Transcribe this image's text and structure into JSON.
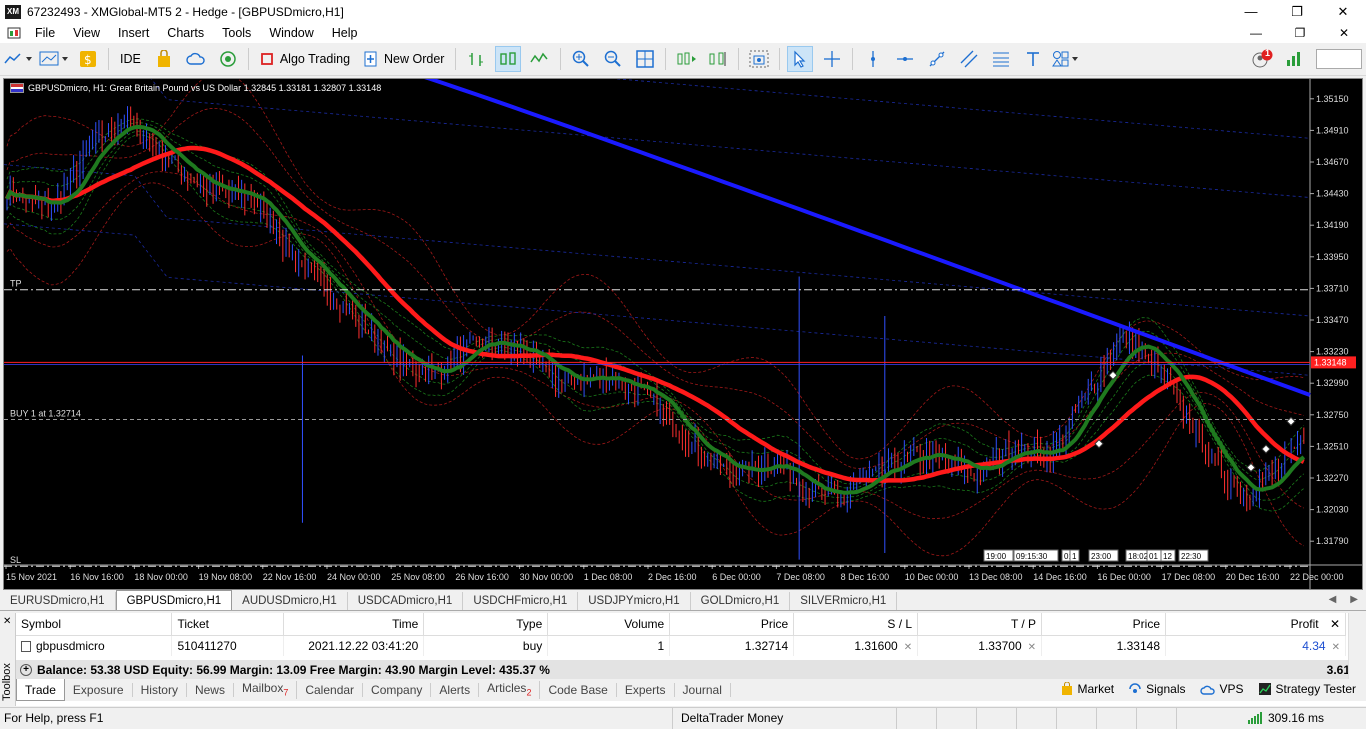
{
  "window": {
    "title": "67232493 - XMGlobal-MT5 2 - Hedge - [GBPUSDmicro,H1]",
    "logo_text": "XM"
  },
  "menu": [
    "File",
    "View",
    "Insert",
    "Charts",
    "Tools",
    "Window",
    "Help"
  ],
  "toolbar": {
    "ide_label": "IDE",
    "algo_trading_label": "Algo Trading",
    "new_order_label": "New Order",
    "notification_count": "1"
  },
  "chart": {
    "header": "GBPUSDmicro, H1:  Great Britain Pound vs US Dollar  1.32845 1.33181 1.32807 1.33148",
    "tp_label": "TP",
    "sl_label": "SL",
    "buy_label": "BUY 1 at 1.32714",
    "price_axis": [
      "1.35150",
      "1.34910",
      "1.34670",
      "1.34430",
      "1.34190",
      "1.33950",
      "1.33710",
      "1.33470",
      "1.33230",
      "1.32990",
      "1.32750",
      "1.32510",
      "1.32270",
      "1.32030",
      "1.31790"
    ],
    "current_price": "1.33148",
    "time_axis": [
      "15 Nov 2021",
      "16 Nov 16:00",
      "18 Nov 00:00",
      "19 Nov 08:00",
      "22 Nov 16:00",
      "24 Nov 00:00",
      "25 Nov 08:00",
      "26 Nov 16:00",
      "30 Nov 00:00",
      "1 Dec 08:00",
      "2 Dec 16:00",
      "6 Dec 00:00",
      "7 Dec 08:00",
      "8 Dec 16:00",
      "10 Dec 00:00",
      "13 Dec 08:00",
      "14 Dec 16:00",
      "16 Dec 00:00",
      "17 Dec 08:00",
      "20 Dec 16:00",
      "22 Dec 00:00"
    ],
    "period_sep_labels": [
      "19:00",
      "09:15:30",
      "01",
      "1",
      "23:00",
      "18:02",
      "01",
      "12",
      "22:30"
    ],
    "colors": {
      "background": "#000000",
      "ma_fast": "#1f7a1f",
      "ma_mid": "#ff1a1a",
      "ma_slow": "#1a1aff",
      "candle_up": "#3050ff",
      "candle_down": "#ff3030",
      "price_line": "#ff2020"
    }
  },
  "symbol_tabs": [
    "EURUSDmicro,H1",
    "GBPUSDmicro,H1",
    "AUDUSDmicro,H1",
    "USDCADmicro,H1",
    "USDCHFmicro,H1",
    "USDJPYmicro,H1",
    "GOLDmicro,H1",
    "SILVERmicro,H1"
  ],
  "trade_table": {
    "headers": [
      "Symbol",
      "Ticket",
      "Time",
      "Type",
      "Volume",
      "Price",
      "S / L",
      "T / P",
      "Price",
      "Profit"
    ],
    "row": {
      "symbol": "gbpusdmicro",
      "ticket": "510411270",
      "time": "2021.12.22 03:41:20",
      "type": "buy",
      "volume": "1",
      "price": "1.32714",
      "sl": "1.31600",
      "tp": "1.33700",
      "current": "1.33148",
      "profit": "4.34"
    },
    "balance_text": "Balance: 53.38 USD  Equity: 56.99  Margin: 13.09  Free Margin: 43.90  Margin Level: 435.37 %",
    "balance_profit": "3.61"
  },
  "toolbox_label": "Toolbox",
  "toolbox_tabs": [
    {
      "label": "Trade",
      "badge": ""
    },
    {
      "label": "Exposure",
      "badge": ""
    },
    {
      "label": "History",
      "badge": ""
    },
    {
      "label": "News",
      "badge": ""
    },
    {
      "label": "Mailbox",
      "badge": "7"
    },
    {
      "label": "Calendar",
      "badge": ""
    },
    {
      "label": "Company",
      "badge": ""
    },
    {
      "label": "Alerts",
      "badge": ""
    },
    {
      "label": "Articles",
      "badge": "2"
    },
    {
      "label": "Code Base",
      "badge": ""
    },
    {
      "label": "Experts",
      "badge": ""
    },
    {
      "label": "Journal",
      "badge": ""
    }
  ],
  "toolbox_right": [
    "Market",
    "Signals",
    "VPS",
    "Strategy Tester"
  ],
  "status": {
    "help": "For Help, press F1",
    "profile": "DeltaTrader Money",
    "ping": "309.16 ms"
  }
}
